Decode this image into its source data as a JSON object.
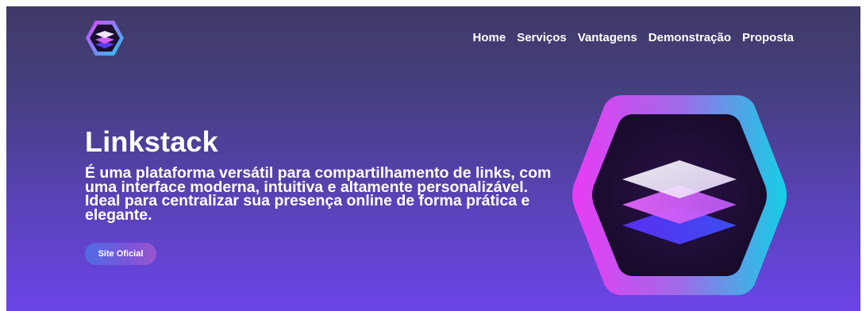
{
  "nav": {
    "items": [
      "Home",
      "Serviços",
      "Vantagens",
      "Demonstração",
      "Proposta"
    ]
  },
  "hero": {
    "title": "Linkstack",
    "description": "É uma plataforma versátil para compartilhamento de links, com uma interface moderna, intuitiva e altamente personalizável. Ideal para centralizar sua presença online de forma prática e elegante.",
    "button_label": "Site Oficial"
  },
  "icons": {
    "logo": "layers-hexagon-logo-icon",
    "hero_art": "layers-hexagon-icon"
  },
  "colors": {
    "gradient_top": "#3f3a66",
    "gradient_bottom": "#6b45e8",
    "hex_border_left": "#e040fb",
    "hex_border_right": "#00d4e8",
    "text": "#ffffff"
  }
}
